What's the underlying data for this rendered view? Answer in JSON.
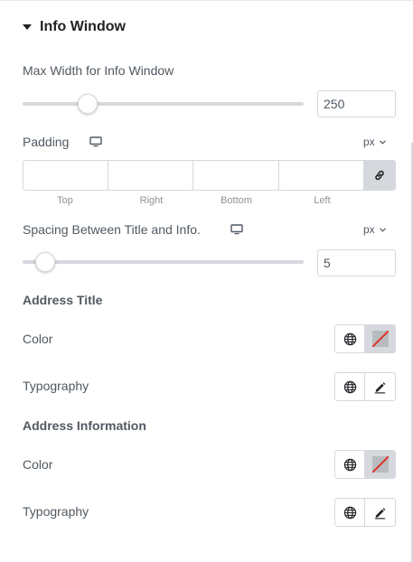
{
  "section": {
    "title": "Info Window"
  },
  "max_width": {
    "label": "Max Width for Info Window",
    "value": "250",
    "slider_fraction": 0.21
  },
  "padding": {
    "label": "Padding",
    "unit": "px",
    "device_icon": "desktop-icon",
    "fields": [
      "Top",
      "Right",
      "Bottom",
      "Left"
    ],
    "link_icon": "link-icon"
  },
  "spacing": {
    "label": "Spacing Between Title and Info.",
    "unit": "px",
    "value": "5",
    "slider_fraction": 0.05,
    "device_icon": "desktop-icon"
  },
  "address_title": {
    "heading": "Address Title",
    "color_label": "Color",
    "typography_label": "Typography"
  },
  "address_info": {
    "heading": "Address Information",
    "color_label": "Color",
    "typography_label": "Typography"
  },
  "icons": {
    "global": "globe-icon",
    "edit": "pencil-icon",
    "clear_color": "no-color-swatch"
  },
  "colors": {
    "accent_text": "#1f2124",
    "muted_text": "#515962",
    "border": "#d5d8dc",
    "swatch_slash": "#e0322b"
  }
}
